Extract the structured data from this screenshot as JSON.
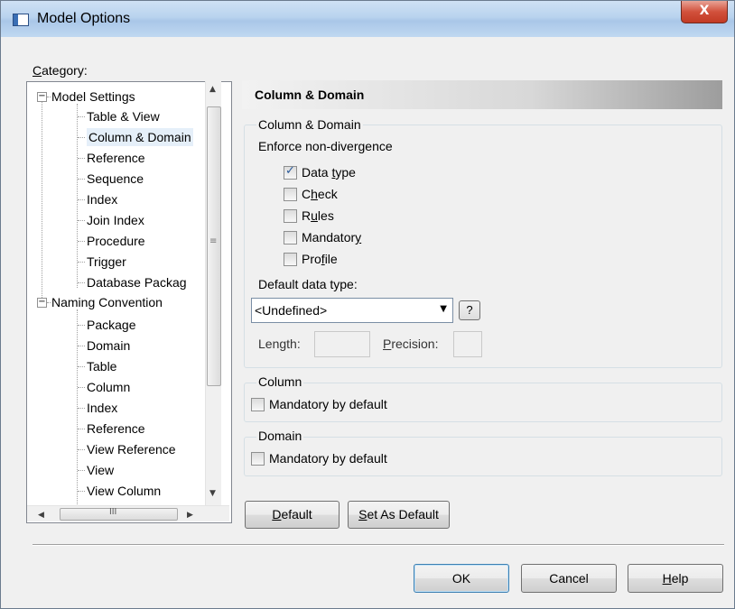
{
  "window": {
    "title": "Model Options",
    "close_label": "X"
  },
  "category": {
    "label_pre": "",
    "label_u": "C",
    "label_post": "ategory:"
  },
  "tree": {
    "model_settings": "Model Settings",
    "model_children": [
      "Table & View",
      "Column & Domain",
      "Reference",
      "Sequence",
      "Index",
      "Join Index",
      "Procedure",
      "Trigger",
      "Database Packag"
    ],
    "naming_convention": "Naming Convention",
    "naming_children": [
      "Package",
      "Domain",
      "Table",
      "Column",
      "Index",
      "Reference",
      "View Reference",
      "View",
      "View Column"
    ],
    "scroll_h_thumb": "III"
  },
  "panel": {
    "header": "Column & Domain",
    "group1_title": "Column & Domain",
    "enforce_label": "Enforce non-divergence",
    "checkboxes": [
      {
        "pre": "Data ",
        "u": "t",
        "post": "ype",
        "checked": true
      },
      {
        "pre": "C",
        "u": "h",
        "post": "eck",
        "checked": false
      },
      {
        "pre": "R",
        "u": "u",
        "post": "les",
        "checked": false
      },
      {
        "pre": "Mandator",
        "u": "y",
        "post": "",
        "checked": false
      },
      {
        "pre": "Pro",
        "u": "f",
        "post": "ile",
        "checked": false
      }
    ],
    "default_type_label": "Default data type:",
    "default_type_value": "<Undefined>",
    "help_button": "?",
    "length_label": "Length:",
    "precision_u": "P",
    "precision_post": "recision:",
    "column_group_title": "Column",
    "column_mandatory": "Mandatory by default",
    "domain_group_title": "Domain",
    "domain_mandatory": "Mandatory by default",
    "default_btn_u": "D",
    "default_btn_post": "efault",
    "set_default_u": "S",
    "set_default_post": "et As Default"
  },
  "footer": {
    "ok": "OK",
    "cancel": "Cancel",
    "help_u": "H",
    "help_post": "elp"
  }
}
